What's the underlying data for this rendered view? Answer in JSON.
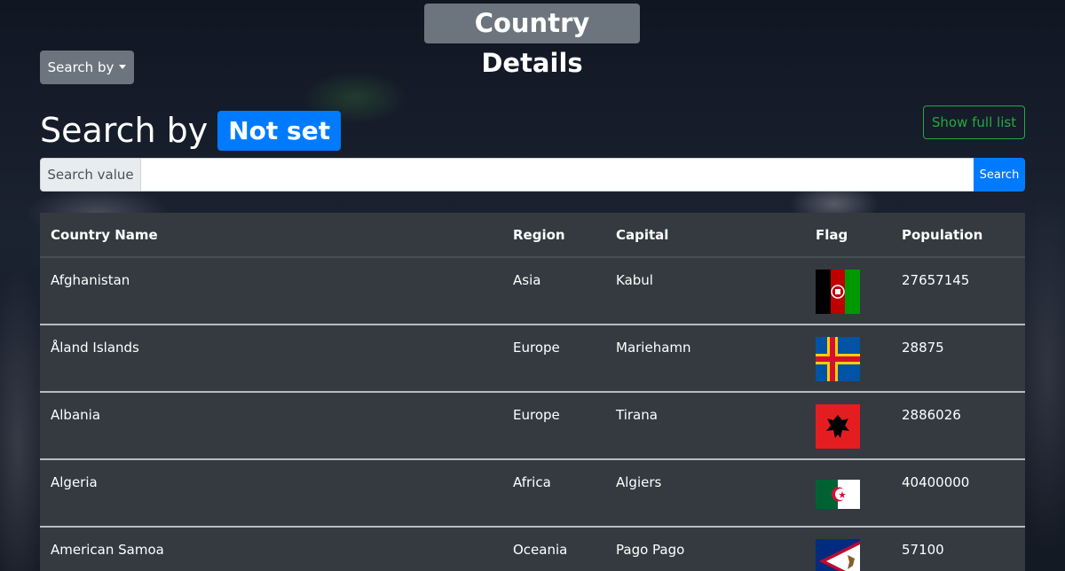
{
  "header": {
    "title": "Country Details"
  },
  "toolbar": {
    "search_by_label": "Search by"
  },
  "search": {
    "heading": "Search by",
    "mode_badge": "Not set",
    "show_full_label": "Show full list",
    "prepend_label": "Search value",
    "input_value": "",
    "button_label": "Search"
  },
  "table": {
    "columns": [
      "Country Name",
      "Region",
      "Capital",
      "Flag",
      "Population"
    ],
    "rows": [
      {
        "name": "Afghanistan",
        "region": "Asia",
        "capital": "Kabul",
        "flag_icon": "afghanistan-flag-icon",
        "population": "27657145"
      },
      {
        "name": "Åland Islands",
        "region": "Europe",
        "capital": "Mariehamn",
        "flag_icon": "aland-islands-flag-icon",
        "population": "28875"
      },
      {
        "name": "Albania",
        "region": "Europe",
        "capital": "Tirana",
        "flag_icon": "albania-flag-icon",
        "population": "2886026"
      },
      {
        "name": "Algeria",
        "region": "Africa",
        "capital": "Algiers",
        "flag_icon": "algeria-flag-icon",
        "population": "40400000"
      },
      {
        "name": "American Samoa",
        "region": "Oceania",
        "capital": "Pago Pago",
        "flag_icon": "american-samoa-flag-icon",
        "population": "57100"
      }
    ]
  },
  "colors": {
    "primary": "#007bff",
    "secondary": "#6c757d",
    "success": "#28a745",
    "table_bg": "#343a40"
  }
}
